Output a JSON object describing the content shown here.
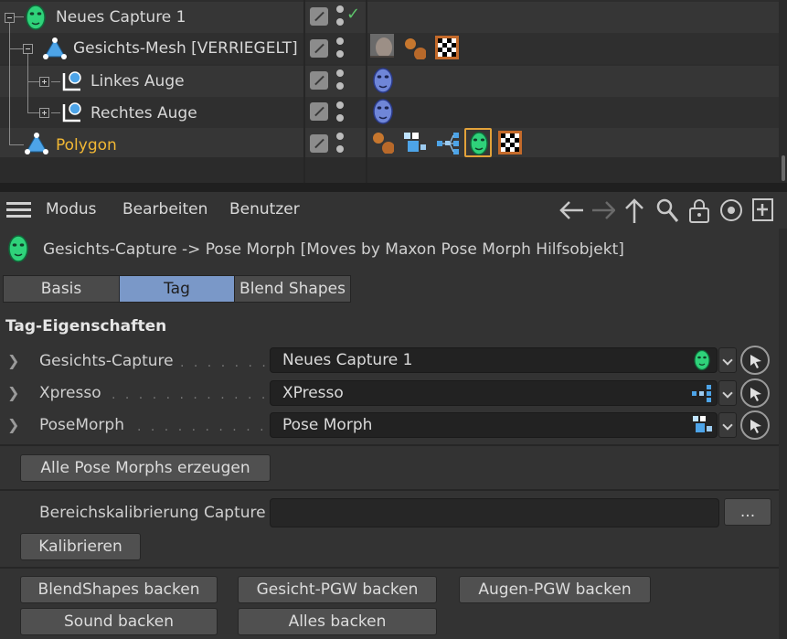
{
  "object_manager": {
    "objects": [
      {
        "name": "Neues Capture 1",
        "selected": false
      },
      {
        "name": "Gesichts-Mesh [VERRIEGELT]",
        "selected": false
      },
      {
        "name": "Linkes Auge",
        "selected": false
      },
      {
        "name": "Rechtes Auge",
        "selected": false
      },
      {
        "name": "Polygon",
        "selected": true
      }
    ],
    "check_mark": "✓"
  },
  "menu": {
    "items": [
      "Modus",
      "Bearbeiten",
      "Benutzer"
    ],
    "nav_icons": [
      "back-arrow-icon",
      "forward-arrow-icon",
      "up-arrow-icon",
      "search-icon",
      "lock-icon",
      "target-icon",
      "new-panel-icon"
    ]
  },
  "attribute_manager": {
    "title": "Gesichts-Capture -> Pose Morph [Moves by Maxon Pose Morph Hilfsobjekt]",
    "tabs": [
      {
        "label": "Basis",
        "active": false
      },
      {
        "label": "Tag",
        "active": true
      },
      {
        "label": "Blend Shapes",
        "active": false
      }
    ],
    "section_title": "Tag-Eigenschaften",
    "properties": [
      {
        "label": "Gesichts-Capture",
        "value": "Neues Capture 1",
        "icon": "face-capture-icon"
      },
      {
        "label": "Xpresso",
        "value": "XPresso",
        "icon": "xpresso-icon"
      },
      {
        "label": "PoseMorph",
        "value": "Pose Morph",
        "icon": "pose-morph-icon"
      }
    ],
    "create_button": "Alle Pose Morphs erzeugen",
    "calibration": {
      "label": "Bereichskalibrierung Capture",
      "value": "",
      "browse_button": "...",
      "calibrate_button": "Kalibrieren"
    },
    "bake_buttons": {
      "blendshapes": "BlendShapes backen",
      "face_pla": "Gesicht-PGW backen",
      "eyes_pla": "Augen-PGW backen",
      "sound": "Sound backen",
      "all": "Alles backen"
    }
  },
  "colors": {
    "accent_tab": "#7a98c8",
    "selected_object": "#f2b834",
    "face_tag_green": "#2fd27a",
    "eye_blue": "#6f86d8"
  }
}
